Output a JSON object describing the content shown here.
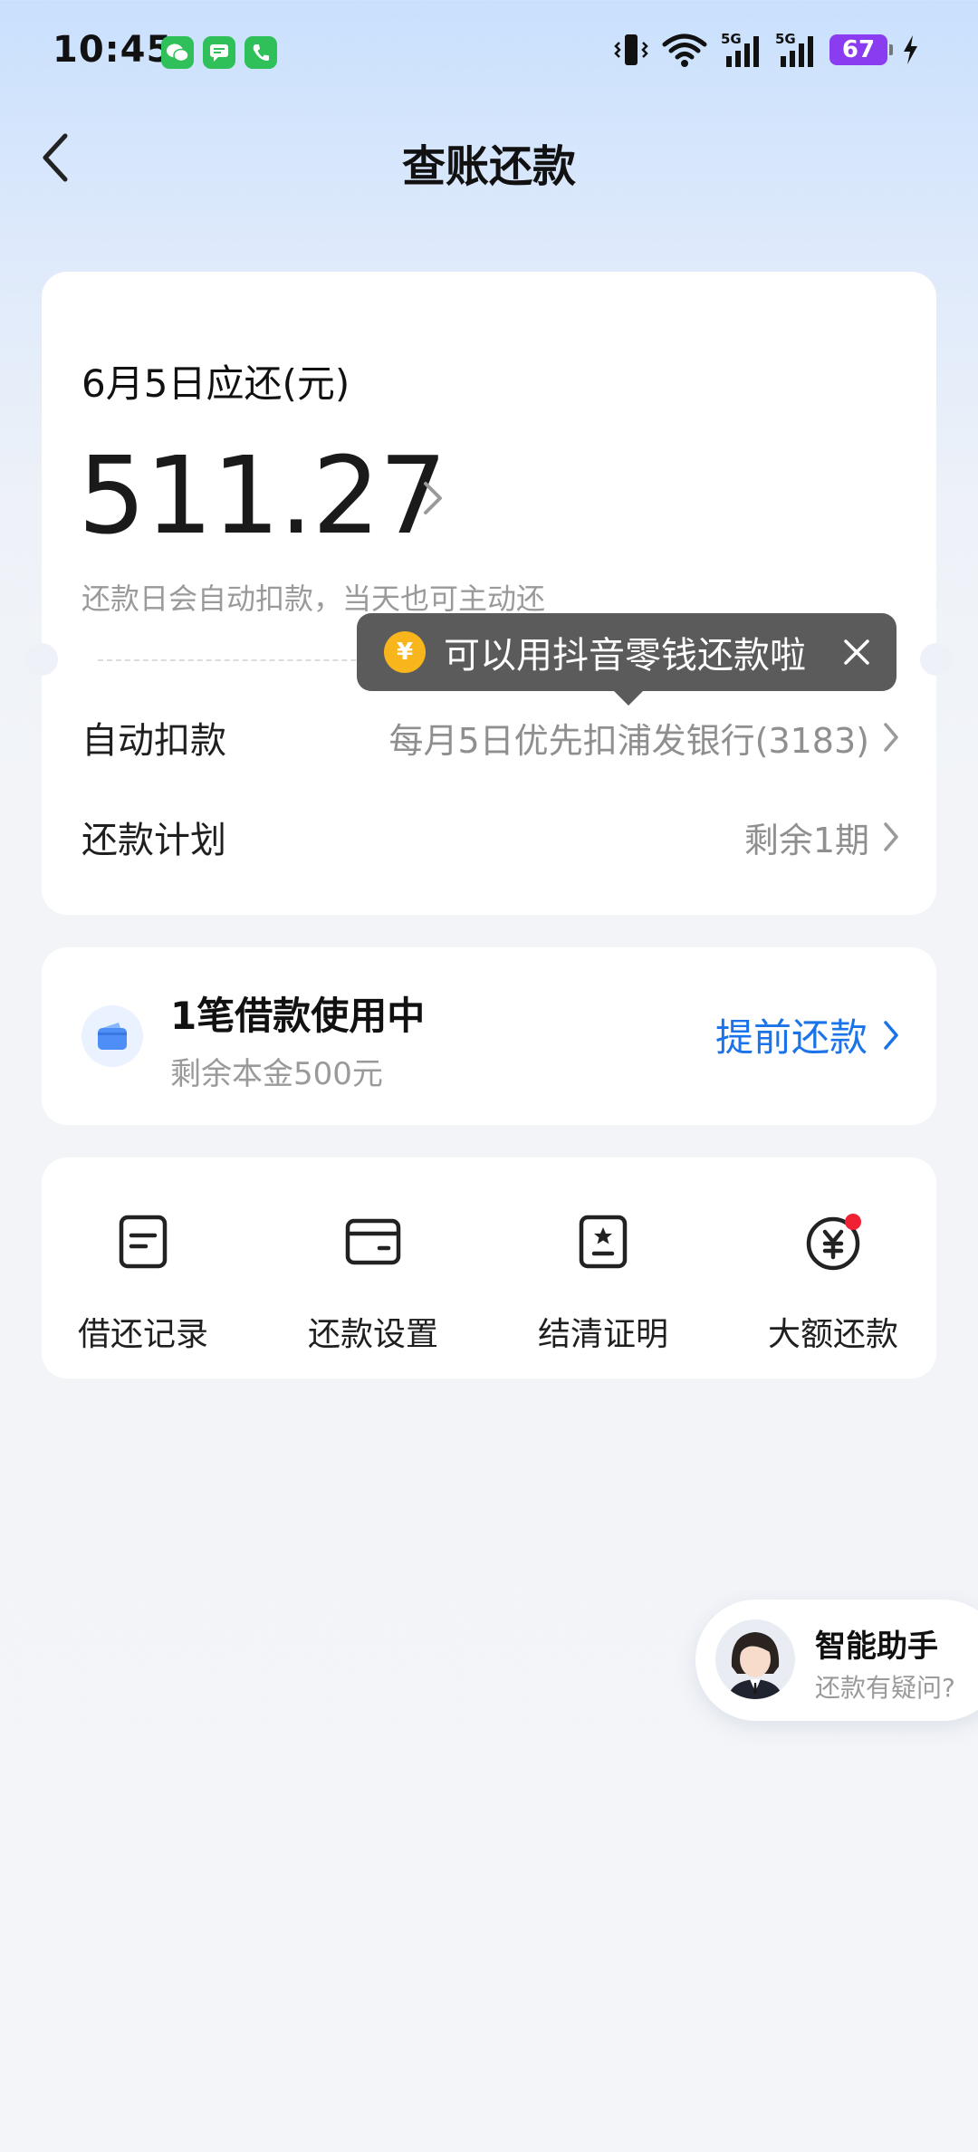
{
  "status_bar": {
    "time": "10:45",
    "network_label_1": "5G",
    "network_label_2": "5G",
    "battery": "67"
  },
  "header": {
    "title": "查账还款"
  },
  "summary": {
    "due_label": "6月5日应还(元)",
    "amount": "511.27",
    "hint": "还款日会自动扣款，当天也可主动还",
    "rows": [
      {
        "label": "自动扣款",
        "value": "每月5日优先扣浦发银行(3183)"
      },
      {
        "label": "还款计划",
        "value": "剩余1期"
      }
    ]
  },
  "tooltip": {
    "yen": "¥",
    "text": "可以用抖音零钱还款啦"
  },
  "loan": {
    "title": "1笔借款使用中",
    "subtitle": "剩余本金500元",
    "action": "提前还款"
  },
  "actions": [
    {
      "label": "借还记录",
      "icon": "record-icon"
    },
    {
      "label": "还款设置",
      "icon": "card-settings-icon"
    },
    {
      "label": "结清证明",
      "icon": "certificate-icon"
    },
    {
      "label": "大额还款",
      "icon": "yen-circle-icon",
      "badge": true
    }
  ],
  "assistant": {
    "title": "智能助手",
    "subtitle": "还款有疑问?"
  },
  "colors": {
    "accent": "#1a73e8",
    "tooltip_bg": "#5b5b5b",
    "coin": "#f8b51c",
    "badge_dot": "#ee2233",
    "battery": "#8a3cf0"
  }
}
